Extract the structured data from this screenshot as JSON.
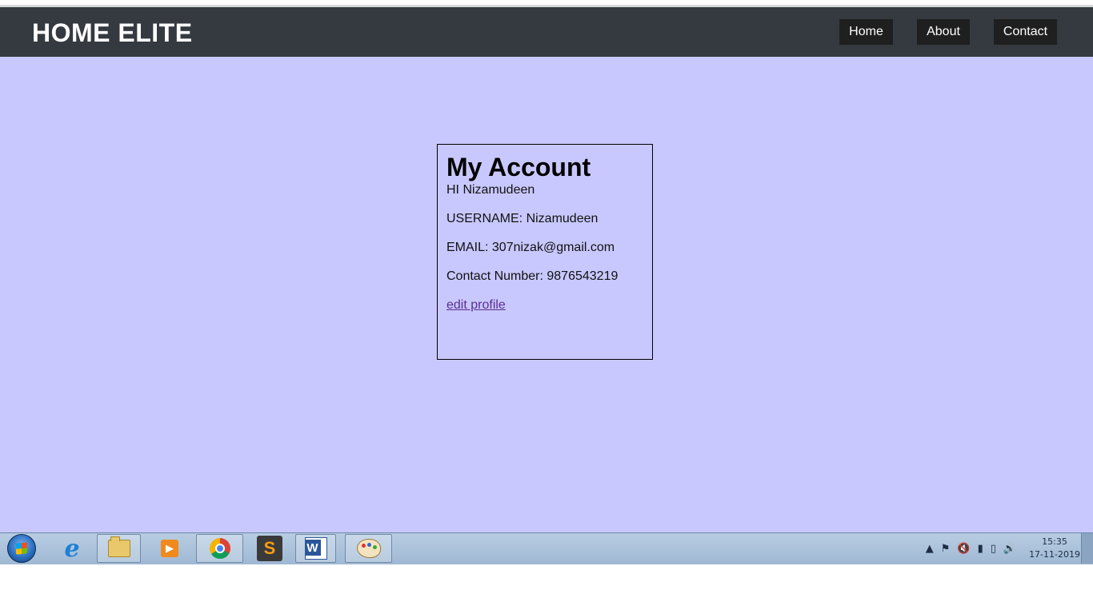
{
  "header": {
    "brand": "HOME ELITE",
    "nav": [
      {
        "label": "Home"
      },
      {
        "label": "About"
      },
      {
        "label": "Contact"
      }
    ]
  },
  "account": {
    "title": "My Account",
    "greeting": "HI Nizamudeen",
    "username": "USERNAME: Nizamudeen",
    "email": "EMAIL: 307nizak@gmail.com",
    "contact": "Contact Number: 9876543219",
    "edit_link": "edit profile"
  },
  "colors": {
    "header_bg": "#343a40",
    "page_bg": "#c8c8ff",
    "nav_button_bg": "#1f1f1f",
    "link_color": "#5b2c91"
  },
  "taskbar": {
    "apps": [
      "start-orb",
      "internet-explorer-icon",
      "windows-explorer-icon",
      "media-player-icon",
      "chrome-icon",
      "sublime-text-icon",
      "word-icon",
      "paint-icon"
    ],
    "tray_icons": [
      "show-hidden-icons",
      "action-center-icon",
      "speaker-muted-icon",
      "network-signal-icon",
      "battery-icon",
      "volume-icon"
    ],
    "time": "15:35",
    "date": "17-11-2019"
  }
}
